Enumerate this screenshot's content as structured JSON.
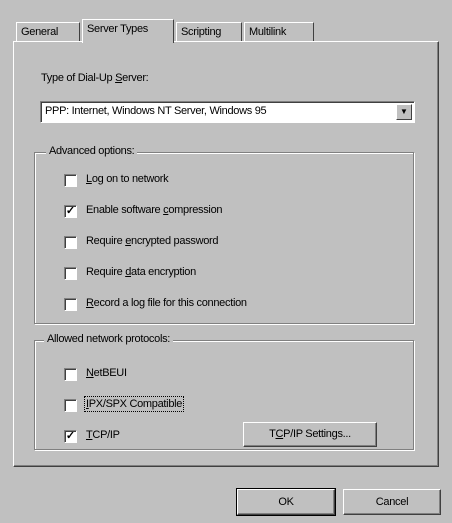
{
  "tabs": [
    {
      "label": "General",
      "active": false
    },
    {
      "label": "Server Types",
      "active": true
    },
    {
      "label": "Scripting",
      "active": false
    },
    {
      "label": "Multilink",
      "active": false
    }
  ],
  "server_type": {
    "label_pre": "Type of Dial-Up ",
    "label_mnemonic": "S",
    "label_post": "erver:",
    "selected": "PPP: Internet, Windows NT Server, Windows 95"
  },
  "advanced": {
    "title": "Advanced options:",
    "options": [
      {
        "mn": "L",
        "rest": "og on to network",
        "pre": "",
        "checked": false
      },
      {
        "pre": "Enable software ",
        "mn": "c",
        "rest": "ompression",
        "checked": true
      },
      {
        "pre": "Require ",
        "mn": "e",
        "rest": "ncrypted password",
        "checked": false
      },
      {
        "pre": "Require ",
        "mn": "d",
        "rest": "ata encryption",
        "checked": false
      },
      {
        "pre": "",
        "mn": "R",
        "rest": "ecord a log file for this connection",
        "checked": false
      }
    ]
  },
  "protocols": {
    "title": "Allowed network protocols:",
    "items": [
      {
        "pre": "",
        "mn": "N",
        "rest": "etBEUI",
        "checked": false
      },
      {
        "pre": "",
        "mn": "I",
        "rest": "PX/SPX Compatible",
        "checked": false
      },
      {
        "pre": "",
        "mn": "T",
        "rest": "CP/IP",
        "checked": true
      }
    ],
    "settings_btn": {
      "pre": "T",
      "mn": "C",
      "rest": "P/IP Settings..."
    }
  },
  "buttons": {
    "ok": "OK",
    "cancel": "Cancel"
  },
  "check_mark": "✓",
  "combo_arrow": "▼"
}
